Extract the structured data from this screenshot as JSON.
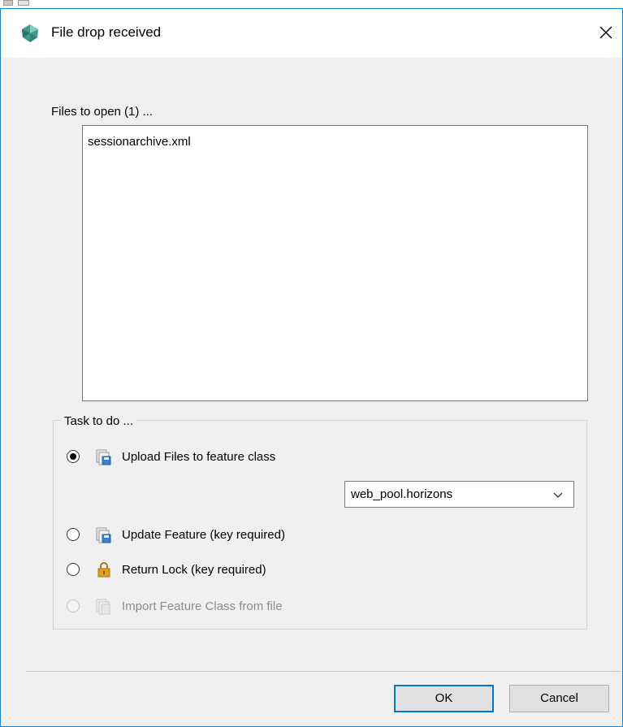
{
  "dialog": {
    "title": "File drop received"
  },
  "files": {
    "label": "Files to open (1) ...",
    "items": [
      "sessionarchive.xml"
    ]
  },
  "task": {
    "legend": "Task to do ...",
    "options": [
      {
        "label": "Upload Files to feature class",
        "checked": true,
        "enabled": true,
        "icon": "upload-file-icon"
      },
      {
        "label": "Update Feature (key required)",
        "checked": false,
        "enabled": true,
        "icon": "update-file-icon"
      },
      {
        "label": "Return Lock (key required)",
        "checked": false,
        "enabled": true,
        "icon": "lock-icon"
      },
      {
        "label": "Import Feature Class from file",
        "checked": false,
        "enabled": false,
        "icon": "import-file-icon"
      }
    ],
    "feature_class": {
      "selected": "web_pool.horizons"
    }
  },
  "buttons": {
    "ok": "OK",
    "cancel": "Cancel"
  },
  "colors": {
    "accent": "#0078d7",
    "app_icon": "#3f9a8c",
    "lock": "#e0a020"
  }
}
